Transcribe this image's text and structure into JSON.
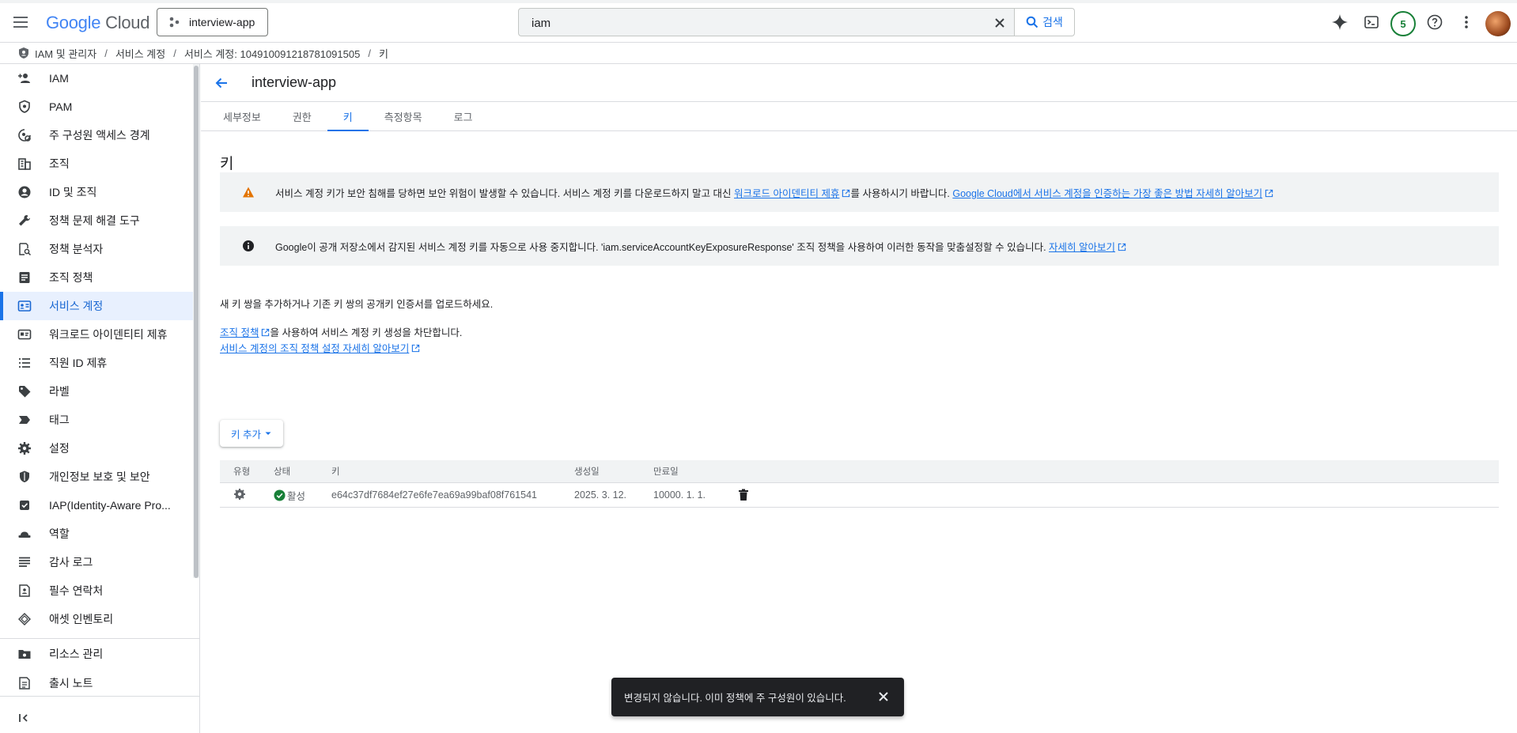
{
  "header": {
    "logo_google": "Google",
    "logo_cloud": "Cloud",
    "project_name": "interview-app",
    "search_value": "iam",
    "search_button": "검색",
    "notifications_count": "5"
  },
  "breadcrumb": {
    "items": [
      "IAM 및 관리자",
      "서비스 계정",
      "서비스 계정: 104910091218781091505",
      "키"
    ]
  },
  "sidebar": {
    "items": [
      {
        "label": "IAM",
        "icon": "person-add-icon"
      },
      {
        "label": "PAM",
        "icon": "shield-lock-icon"
      },
      {
        "label": "주 구성원 액세스 경계",
        "icon": "access-boundary-icon"
      },
      {
        "label": "조직",
        "icon": "building-icon"
      },
      {
        "label": "ID 및 조직",
        "icon": "account-circle-icon"
      },
      {
        "label": "정책 문제 해결 도구",
        "icon": "wrench-icon"
      },
      {
        "label": "정책 분석자",
        "icon": "policy-search-icon"
      },
      {
        "label": "조직 정책",
        "icon": "list-doc-icon"
      },
      {
        "label": "서비스 계정",
        "icon": "service-account-icon"
      },
      {
        "label": "워크로드 아이덴티티 제휴",
        "icon": "id-card-icon"
      },
      {
        "label": "직원 ID 제휴",
        "icon": "list-icon"
      },
      {
        "label": "라벨",
        "icon": "label-icon"
      },
      {
        "label": "태그",
        "icon": "tag-icon"
      },
      {
        "label": "설정",
        "icon": "gear-icon"
      },
      {
        "label": "개인정보 보호 및 보안",
        "icon": "shield-icon"
      },
      {
        "label": "IAP(Identity-Aware Pro...",
        "icon": "iap-icon"
      },
      {
        "label": "역할",
        "icon": "hat-icon"
      },
      {
        "label": "감사 로그",
        "icon": "lines-icon"
      },
      {
        "label": "필수 연락처",
        "icon": "contact-doc-icon"
      },
      {
        "label": "애셋 인벤토리",
        "icon": "diamond-icon"
      }
    ],
    "bottom_items": [
      {
        "label": "리소스 관리",
        "icon": "folder-gear-icon"
      },
      {
        "label": "출시 노트",
        "icon": "release-notes-icon"
      }
    ]
  },
  "page": {
    "title": "interview-app",
    "tabs": [
      "세부정보",
      "권한",
      "키",
      "측정항목",
      "로그"
    ],
    "section_title": "키",
    "warning": {
      "text1": "서비스 계정 키가 보안 침해를 당하면 보안 위험이 발생할 수 있습니다. 서비스 계정 키를 다운로드하지 말고 대신 ",
      "link1": "워크로드 아이덴티티 제휴",
      "text2": "를 사용하시기 바랍니다. ",
      "link2": "Google Cloud에서 서비스 계정을 인증하는 가장 좋은 방법 자세히 알아보기"
    },
    "info": {
      "text1": "Google이 공개 저장소에서 감지된 서비스 계정 키를 자동으로 사용 중지합니다. 'iam.serviceAccountKeyExposureResponse' 조직 정책을 사용하여 이러한 동작을 맞춤설정할 수 있습니다. ",
      "link1": "자세히 알아보기"
    },
    "add_pair_text": "새 키 쌍을 추가하거나 기존 키 쌍의 공개키 인증서를 업로드하세요.",
    "org_policy_link": "조직 정책",
    "org_policy_text": "을 사용하여 서비스 계정 키 생성을 차단합니다.",
    "org_policy_learn_link": "서비스 계정의 조직 정책 설정 자세히 알아보기",
    "add_key_button": "키 추가",
    "table": {
      "columns": [
        "유형",
        "상태",
        "키",
        "생성일",
        "만료일"
      ],
      "rows": [
        {
          "status": "활성",
          "key": "e64c37df7684ef27e6fe7ea69a99baf08f761541",
          "created": "2025. 3. 12.",
          "expiry": "10000. 1. 1."
        }
      ]
    }
  },
  "snackbar": {
    "message": "변경되지 않습니다. 이미 정책에 주 구성원이 있습니다."
  },
  "colors": {
    "accent": "#1a73e8",
    "warning": "#e37400",
    "active_green": "#188038"
  }
}
